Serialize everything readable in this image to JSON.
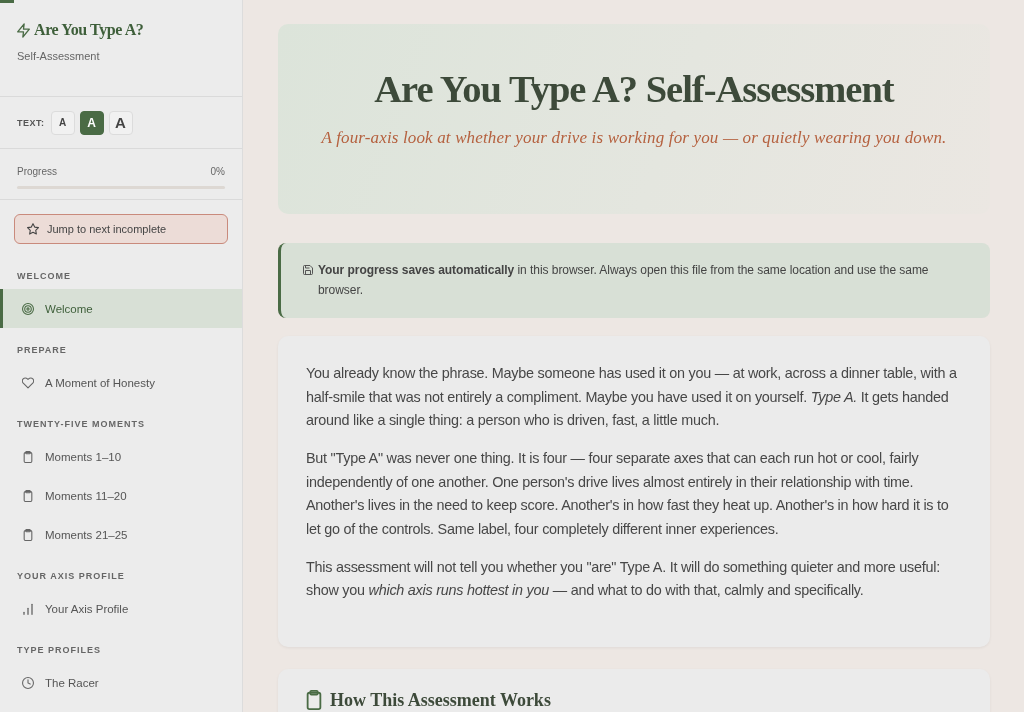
{
  "page_progress": {
    "level": 0.014
  },
  "sidebar": {
    "title": "Are You Type A?",
    "subtitle": "Self-Assessment",
    "text_size": {
      "label": "TEXT:",
      "options": [
        {
          "label": "A",
          "kind": "small",
          "selected": false
        },
        {
          "label": "A",
          "kind": "medium",
          "selected": true
        },
        {
          "label": "A",
          "kind": "large",
          "selected": false
        }
      ]
    },
    "progress": {
      "label": "Progress",
      "value": "0%",
      "level": 0
    },
    "jump_button": {
      "label": "Jump to next incomplete"
    },
    "sections": [
      {
        "heading": "WELCOME",
        "items": [
          {
            "label": "Welcome",
            "kind": "welcome",
            "selected": true
          }
        ]
      },
      {
        "heading": "PREPARE",
        "items": [
          {
            "label": "A Moment of Honesty",
            "kind": "prepare",
            "selected": false
          }
        ]
      },
      {
        "heading": "TWENTY-FIVE MOMENTS",
        "items": [
          {
            "label": "Moments 1–10",
            "kind": "moments",
            "selected": false
          },
          {
            "label": "Moments 11–20",
            "kind": "moments",
            "selected": false
          },
          {
            "label": "Moments 21–25",
            "kind": "moments",
            "selected": false
          }
        ]
      },
      {
        "heading": "YOUR AXIS PROFILE",
        "items": [
          {
            "label": "Your Axis Profile",
            "kind": "axis",
            "selected": false
          }
        ]
      },
      {
        "heading": "TYPE PROFILES",
        "items": [
          {
            "label": "The Racer",
            "kind": "profile",
            "selected": false
          }
        ]
      }
    ]
  },
  "hero": {
    "title": "Are You Type A? Self-Assessment",
    "subtitle": "A four-axis look at whether your drive is working for you — or quietly wearing you down."
  },
  "notice": {
    "text": "**Your progress saves automatically** in this browser. Always open this file from the same location and use the same browser."
  },
  "intro": {
    "paragraphs": [
      "You already know the phrase. Maybe someone has used it on you — at work, across a dinner table, with a half-smile that was not entirely a compliment. Maybe you have used it on yourself. *Type A.* It gets handed around like a single thing: a person who is driven, fast, a little much.",
      "But \"Type A\" was never one thing. It is four — four separate axes that can each run hot or cool, fairly independently of one another. One person's drive lives almost entirely in their relationship with time. Another's lives in the need to keep score. Another's in how fast they heat up. Another's in how hard it is to let go of the controls. Same label, four completely different inner experiences.",
      "This assessment will not tell you whether you \"are\" Type A. It will do something quieter and more useful: show you *which axis runs hottest in you* — and what to do with that, calmly and specifically."
    ]
  },
  "next_section": {
    "title": "How This Assessment Works"
  }
}
